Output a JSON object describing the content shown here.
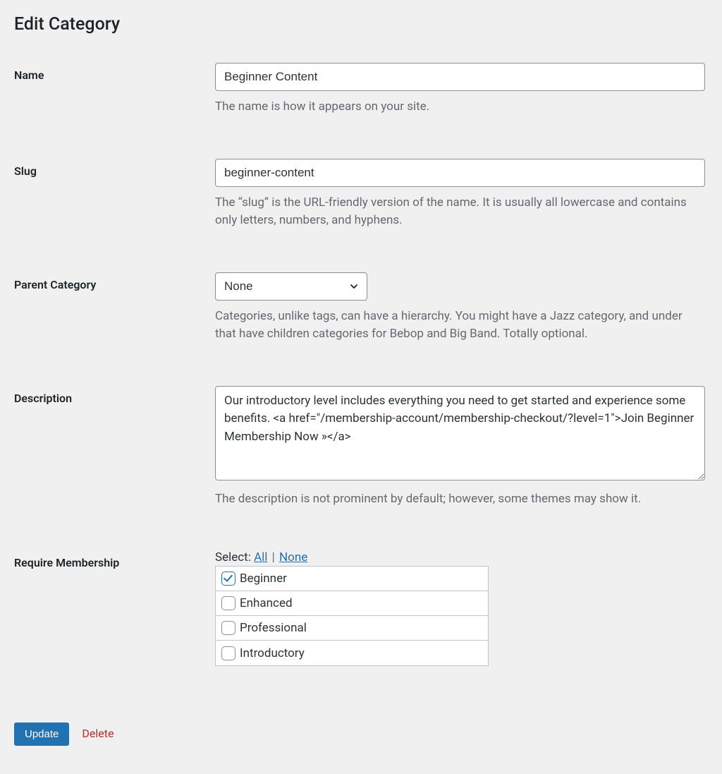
{
  "page": {
    "title": "Edit Category"
  },
  "fields": {
    "name": {
      "label": "Name",
      "value": "Beginner Content",
      "help": "The name is how it appears on your site."
    },
    "slug": {
      "label": "Slug",
      "value": "beginner-content",
      "help": "The “slug” is the URL-friendly version of the name. It is usually all lowercase and contains only letters, numbers, and hyphens."
    },
    "parent": {
      "label": "Parent Category",
      "value": "None",
      "help": "Categories, unlike tags, can have a hierarchy. You might have a Jazz category, and under that have children categories for Bebop and Big Band. Totally optional."
    },
    "description": {
      "label": "Description",
      "value": "Our introductory level includes everything you need to get started and experience some benefits. <a href=\"/membership-account/membership-checkout/?level=1\">Join Beginner Membership Now »</a>",
      "help": "The description is not prominent by default; however, some themes may show it."
    },
    "membership": {
      "label": "Require Membership",
      "select_prefix": "Select:",
      "all": "All",
      "none": "None",
      "items": [
        {
          "label": "Beginner",
          "checked": true
        },
        {
          "label": "Enhanced",
          "checked": false
        },
        {
          "label": "Professional",
          "checked": false
        },
        {
          "label": "Introductory",
          "checked": false
        }
      ]
    }
  },
  "actions": {
    "update": "Update",
    "delete": "Delete"
  }
}
